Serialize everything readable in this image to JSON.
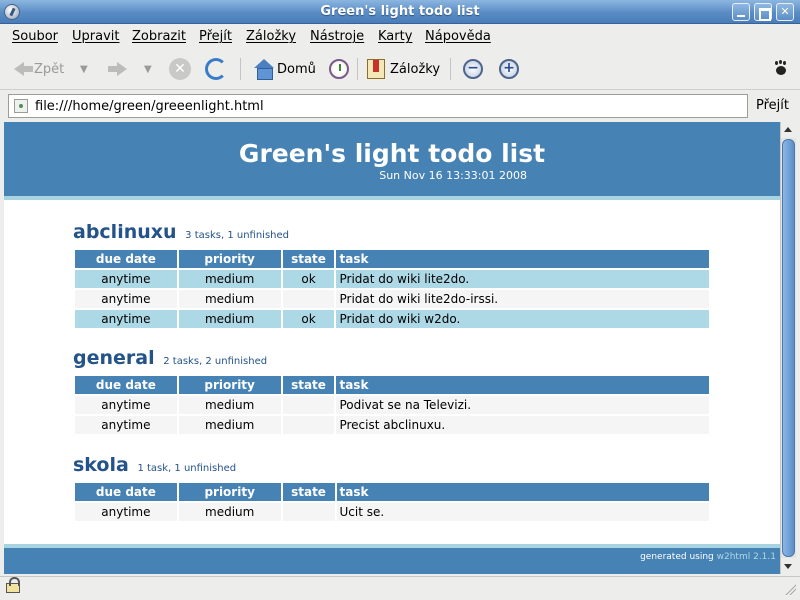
{
  "window": {
    "title": "Green's light todo list"
  },
  "menu": [
    "Soubor",
    "Upravit",
    "Zobrazit",
    "Přejít",
    "Záložky",
    "Nástroje",
    "Karty",
    "Nápověda"
  ],
  "toolbar": {
    "back_label": "Zpět",
    "home_label": "Domů",
    "bookmarks_label": "Záložky",
    "zoom_out_glyph": "−",
    "zoom_in_glyph": "+"
  },
  "urlbar": {
    "url": "file:///home/green/greeenlight.html",
    "go_label": "Přejít"
  },
  "page": {
    "title": "Green's light todo list",
    "date": "Sun Nov 16 13:33:01 2008",
    "columns": [
      "due date",
      "priority",
      "state",
      "task"
    ],
    "sections": [
      {
        "name": "abclinuxu",
        "meta": "3 tasks, 1 unfinished",
        "rows": [
          {
            "due": "anytime",
            "priority": "medium",
            "state": "ok",
            "task": "Pridat do wiki lite2do."
          },
          {
            "due": "anytime",
            "priority": "medium",
            "state": "",
            "task": "Pridat do wiki lite2do-irssi."
          },
          {
            "due": "anytime",
            "priority": "medium",
            "state": "ok",
            "task": "Pridat do wiki w2do."
          }
        ]
      },
      {
        "name": "general",
        "meta": "2 tasks, 2 unfinished",
        "rows": [
          {
            "due": "anytime",
            "priority": "medium",
            "state": "",
            "task": "Podivat se na Televizi."
          },
          {
            "due": "anytime",
            "priority": "medium",
            "state": "",
            "task": "Precist abclinuxu."
          }
        ]
      },
      {
        "name": "skola",
        "meta": "1 task, 1 unfinished",
        "rows": [
          {
            "due": "anytime",
            "priority": "medium",
            "state": "",
            "task": "Ucit se."
          }
        ]
      }
    ],
    "footer": {
      "prefix": "generated using",
      "generator": "w2html 2.1.1"
    }
  },
  "colors": {
    "header": "#4682b4",
    "accent_border": "#a8d4e2",
    "row_done": "#add8e6",
    "row_open": "#f5f5f5",
    "section_title": "#24538a"
  },
  "icons": {
    "app": "browser-icon",
    "back": "back-arrow-icon",
    "forward": "forward-arrow-icon",
    "stop": "stop-icon",
    "reload": "reload-icon",
    "home": "home-icon",
    "history": "history-icon",
    "bookmarks": "bookmarks-icon",
    "zoom_out": "zoom-out-icon",
    "zoom_in": "zoom-in-icon",
    "throbber": "paw-icon",
    "site": "site-identity-icon",
    "security": "lock-icon"
  }
}
